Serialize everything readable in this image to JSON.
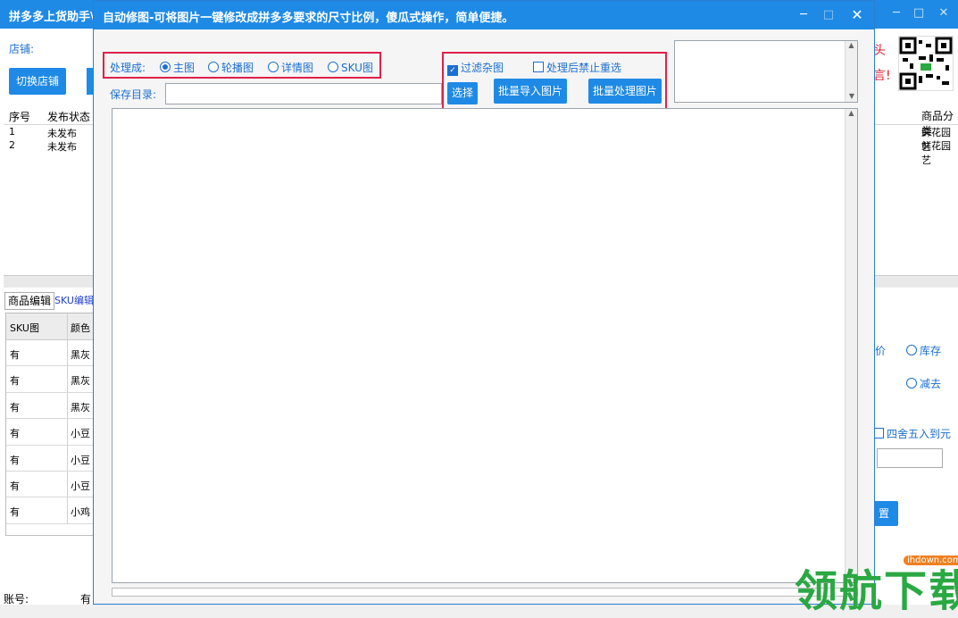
{
  "bg": {
    "title": "拼多多上货助手\\",
    "store_label": "店铺:",
    "switch_store": "切换店铺",
    "grid_headers": [
      "序号",
      "发布状态"
    ],
    "grid_rows": [
      [
        "1",
        "未发布"
      ],
      [
        "2",
        "未发布"
      ]
    ],
    "tabs": [
      "商品编辑",
      "SKU编辑"
    ],
    "sku_headers": [
      "SKU图",
      "颜色"
    ],
    "sku_rows": [
      [
        "有",
        "黑灰"
      ],
      [
        "有",
        "黑灰"
      ],
      [
        "有",
        "黑灰"
      ],
      [
        "有",
        "小豆"
      ],
      [
        "有",
        "小豆"
      ],
      [
        "有",
        "小豆"
      ],
      [
        "有",
        "小鸡"
      ]
    ],
    "status_account": "账号:",
    "status_you": "有",
    "right_hint1": "头",
    "right_hint2": "言!",
    "category_head": "商品分类",
    "categories": [
      "鲜花园艺",
      "鲜花园艺"
    ],
    "price_label": "价",
    "stock_label": "库存",
    "reduce_label": "减去",
    "round_label": "四舍五入到元",
    "right_btn": "置"
  },
  "dialog": {
    "title": "自动修图-可将图片一键修改成拼多多要求的尺寸比例，傻瓜式操作，简单便捷。",
    "process_label": "处理成:",
    "radios": [
      {
        "label": "主图",
        "selected": true
      },
      {
        "label": "轮播图",
        "selected": false
      },
      {
        "label": "详情图",
        "selected": false
      },
      {
        "label": "SKU图",
        "selected": false
      }
    ],
    "save_label": "保存目录:",
    "save_value": "",
    "filter_label": "过滤杂图",
    "filter_checked": true,
    "noreselect_label": "处理后禁止重选",
    "noreselect_checked": false,
    "choose_btn": "选择",
    "import_btn": "批量导入图片",
    "process_btn": "批量处理图片"
  },
  "watermark": {
    "url": "ihdown.com",
    "text": "领航下载"
  },
  "colors": {
    "accent": "#1e8ae6",
    "highlight_box": "#e0204a",
    "label_blue": "#1c6fd1"
  }
}
